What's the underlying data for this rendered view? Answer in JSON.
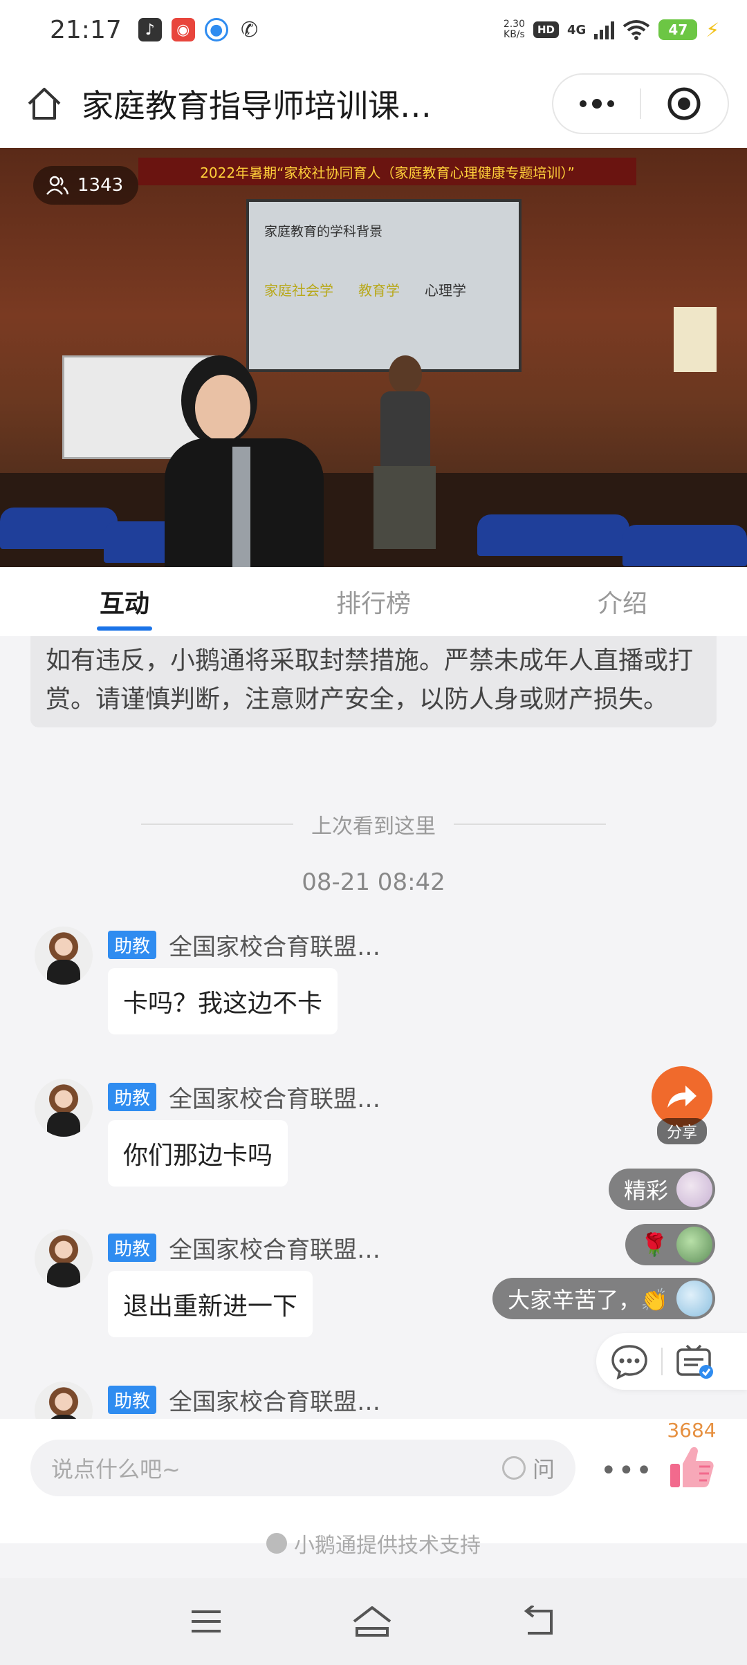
{
  "status": {
    "time": "21:17",
    "net_speed_value": "2.30",
    "net_speed_unit": "KB/s",
    "hd": "HD",
    "network": "4G",
    "battery": "47"
  },
  "header": {
    "title": "家庭教育指导师培训课…"
  },
  "video": {
    "viewer_count": "1343",
    "banner_text": "2022年暑期“家校社协同育人（家庭教育心理健康专题培训）”",
    "screen_title": "家庭教育的学科背景",
    "screen_terms": [
      "家庭社会学",
      "教育学",
      "心理学"
    ]
  },
  "tabs": [
    {
      "label": "互动",
      "active": true
    },
    {
      "label": "排行榜",
      "active": false
    },
    {
      "label": "介绍",
      "active": false
    }
  ],
  "notice": {
    "text": "系统提示：直播内容及互动评论严禁传播违法或不良信息，如有违反，小鹅通将采取封禁措施。严禁未成年人直播或打赏。请谨慎判断，注意财产安全，以防人身或财产损失。"
  },
  "feed": {
    "last_seen_label": "上次看到这里",
    "timestamp": "08-21 08:42",
    "messages": [
      {
        "role": "助教",
        "sender": "全国家校合育联盟…",
        "text": "卡吗？我这边不卡"
      },
      {
        "role": "助教",
        "sender": "全国家校合育联盟…",
        "text": "你们那边卡吗"
      },
      {
        "role": "助教",
        "sender": "全国家校合育联盟…",
        "text": "退出重新进一下"
      },
      {
        "role": "助教",
        "sender": "全国家校合育联盟…",
        "text": ""
      }
    ]
  },
  "share": {
    "label": "分享"
  },
  "reactions": [
    {
      "text": "精彩"
    },
    {
      "text": "🌹"
    },
    {
      "text": "大家辛苦了，👏"
    }
  ],
  "input": {
    "placeholder": "说点什么吧~",
    "ask_label": "问",
    "like_count": "3684"
  },
  "footer": {
    "support_text": "小鹅通提供技术支持"
  }
}
